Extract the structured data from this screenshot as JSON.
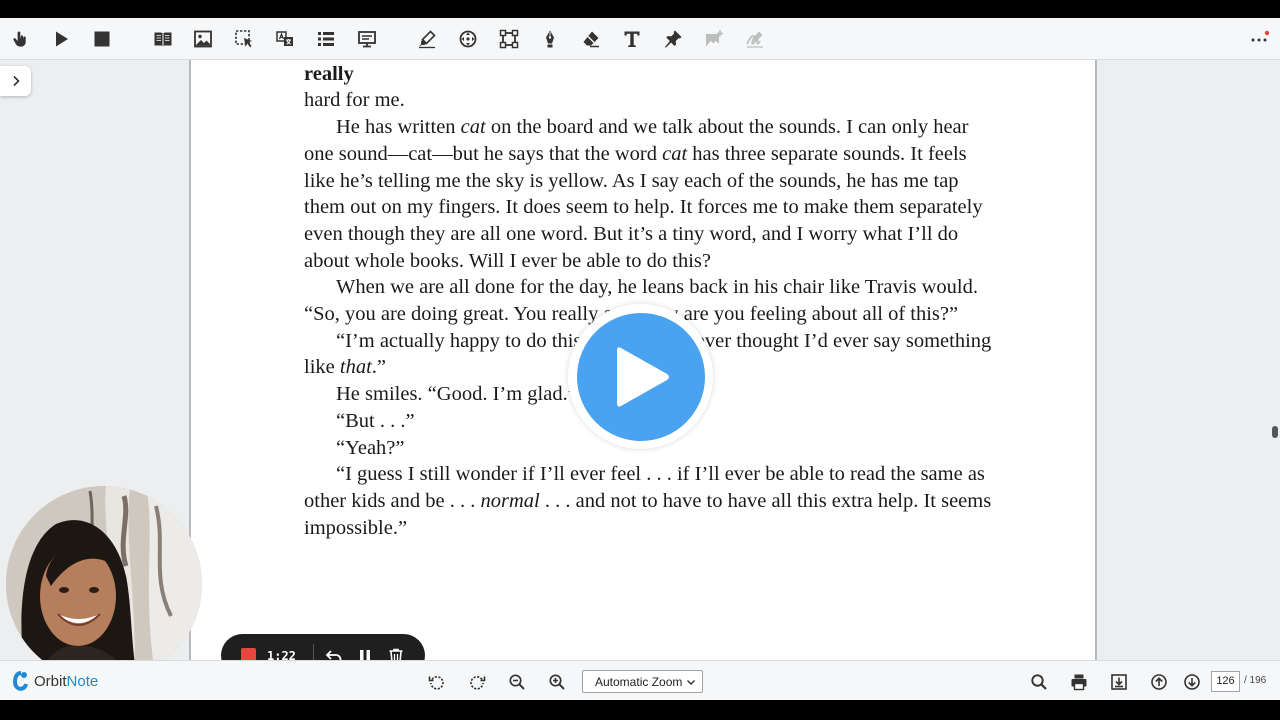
{
  "book": {
    "top_cut": "working with Mr. Daniels gets easier because I am happy. But the work is really",
    "paragraphs": [
      {
        "indent": false,
        "parts": [
          {
            "t": "hard for me."
          }
        ]
      },
      {
        "indent": true,
        "parts": [
          {
            "t": "He has written "
          },
          {
            "t": "cat",
            "i": true
          },
          {
            "t": " on the board and we talk about the sounds. I can only hear one sound—cat—but he says that the word "
          },
          {
            "t": "cat",
            "i": true
          },
          {
            "t": " has three separate sounds. It feels like he’s telling me the sky is yellow. As I say each of the sounds, he has me tap them out on my fingers. It does seem to help. It forces me to make them separately even though they are all one word. But it’s a tiny word, and I worry what I’ll do about whole books. Will I ever be able to do this?"
          }
        ]
      },
      {
        "indent": true,
        "parts": [
          {
            "t": "When we are all done for the day, he leans back in his chair like Travis would. “So, you are doing great. You really are. How are you feeling about all of this?”"
          }
        ]
      },
      {
        "indent": true,
        "parts": [
          {
            "t": "“I’m actually happy to do this work, and I never thought I’d ever say something like "
          },
          {
            "t": "that",
            "i": true
          },
          {
            "t": ".”"
          }
        ]
      },
      {
        "indent": true,
        "parts": [
          {
            "t": "He smiles. “Good. I’m glad.”"
          }
        ]
      },
      {
        "indent": true,
        "parts": [
          {
            "t": "“But . . .”"
          }
        ]
      },
      {
        "indent": true,
        "parts": [
          {
            "t": "“Yeah?”"
          }
        ]
      },
      {
        "indent": true,
        "parts": [
          {
            "t": "“I guess I still wonder if I’ll ever feel . . . if I’ll ever be able to read the same as other kids and be . . . "
          },
          {
            "t": "normal",
            "i": true
          },
          {
            "t": " . . . and not to have to have all this extra help. It seems impossible.”"
          }
        ]
      }
    ]
  },
  "recorder": {
    "time": "1:22"
  },
  "footer": {
    "logo_orbit": "Orbit",
    "logo_note": "Note",
    "zoom": "Automatic Zoom",
    "page_current": "126",
    "page_total": "/ 196"
  },
  "colors": {
    "accent": "#4aa3f0",
    "record": "#e8453c",
    "logo_blue": "#1f8ad8"
  },
  "icons": {
    "toolbar_left": [
      "hand-pointer-icon",
      "play-icon",
      "stop-icon",
      "book-icon",
      "image-icon",
      "select-area-icon",
      "translate-icon",
      "list-icon",
      "presentation-icon"
    ],
    "toolbar_tools": [
      "highlighter-icon",
      "move-icon",
      "shape-icon",
      "pen-icon",
      "eraser-icon",
      "text-icon",
      "pin-icon",
      "add-image-icon",
      "signature-icon"
    ],
    "toolbar_right": [
      "more-icon"
    ]
  }
}
